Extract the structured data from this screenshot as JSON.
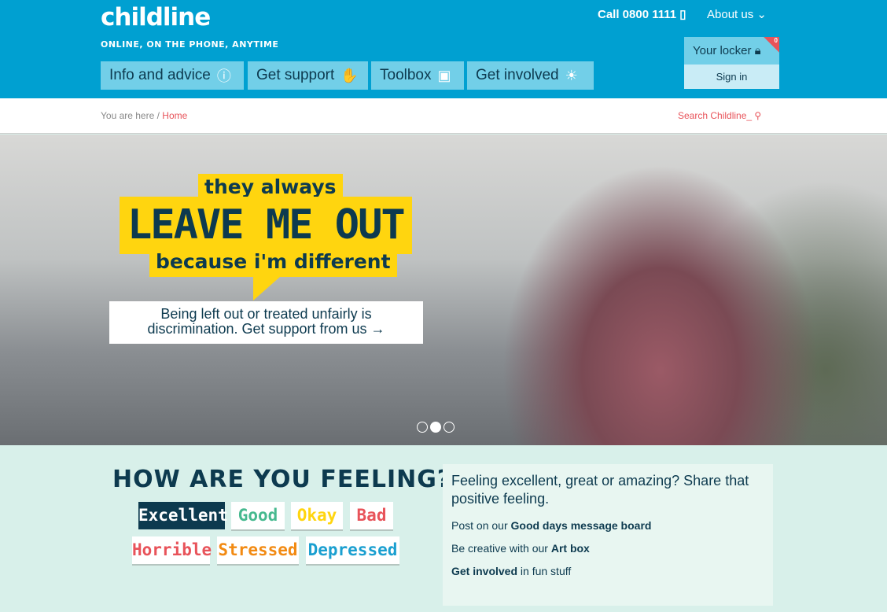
{
  "header": {
    "logo": "childline",
    "tagline": "ONLINE, ON THE PHONE, ANYTIME",
    "call": "Call 0800 1111",
    "about": "About us",
    "nav": [
      {
        "label": "Info and advice",
        "icon": "info-icon"
      },
      {
        "label": "Get support",
        "icon": "hand-icon"
      },
      {
        "label": "Toolbox",
        "icon": "toolbox-icon"
      },
      {
        "label": "Get involved",
        "icon": "lightbulb-icon"
      }
    ],
    "locker": {
      "label": "Your locker",
      "count": "0",
      "sign_in": "Sign in"
    }
  },
  "breadcrumb": {
    "prefix": "You are here /",
    "home": "Home"
  },
  "search": {
    "label": "Search Childline_"
  },
  "hero": {
    "line1": "they always",
    "line2": "LEAVE ME OUT",
    "line3": "because i'm different",
    "cta_line1": "Being left out or treated unfairly is",
    "cta_line2": "discrimination. Get support from us →",
    "slides": 3,
    "active_slide": 2
  },
  "feeling": {
    "title": "HOW ARE YOU FEELING?",
    "moods": [
      {
        "label": "Excellent",
        "color": "#ffffff"
      },
      {
        "label": "Good",
        "color": "#46b98f"
      },
      {
        "label": "Okay",
        "color": "#ffd50f"
      },
      {
        "label": "Bad",
        "color": "#e8535a"
      },
      {
        "label": "Horrible",
        "color": "#e8535a"
      },
      {
        "label": "Stressed",
        "color": "#f28a12"
      },
      {
        "label": "Depressed",
        "color": "#1a9fd0"
      }
    ],
    "selected": "Excellent"
  },
  "panel": {
    "heading": "Feeling excellent, great or amazing? Share that positive feeling.",
    "item1_pre": "Post on our ",
    "item1_link": "Good days message board",
    "item2_pre": "Be creative with our ",
    "item2_link": "Art box",
    "item3_link": "Get involved",
    "item3_post": " in fun stuff"
  }
}
